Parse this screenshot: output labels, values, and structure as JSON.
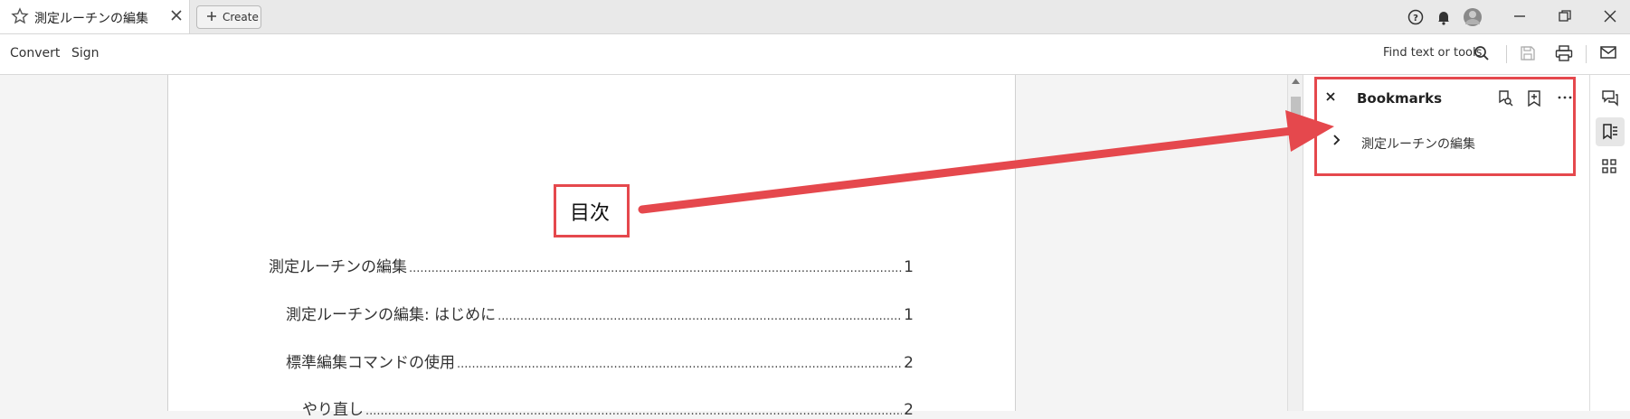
{
  "tab": {
    "title": "測定ルーチンの編集"
  },
  "create_label": "Create",
  "toolbar": {
    "convert": "Convert",
    "sign": "Sign",
    "find": "Find text or tools"
  },
  "document": {
    "toc_title": "目次",
    "toc": [
      {
        "text": "測定ルーチンの編集",
        "page": "1"
      },
      {
        "text": "測定ルーチンの編集: はじめに",
        "page": "1"
      },
      {
        "text": "標準編集コマンドの使用",
        "page": "2"
      },
      {
        "text": "やり直し",
        "page": "2"
      }
    ]
  },
  "panel": {
    "title": "Bookmarks",
    "bookmarks": [
      {
        "label": "測定ルーチンの編集"
      }
    ]
  },
  "colors": {
    "annotation": "#e5484d",
    "arrow": "#e5484d"
  }
}
